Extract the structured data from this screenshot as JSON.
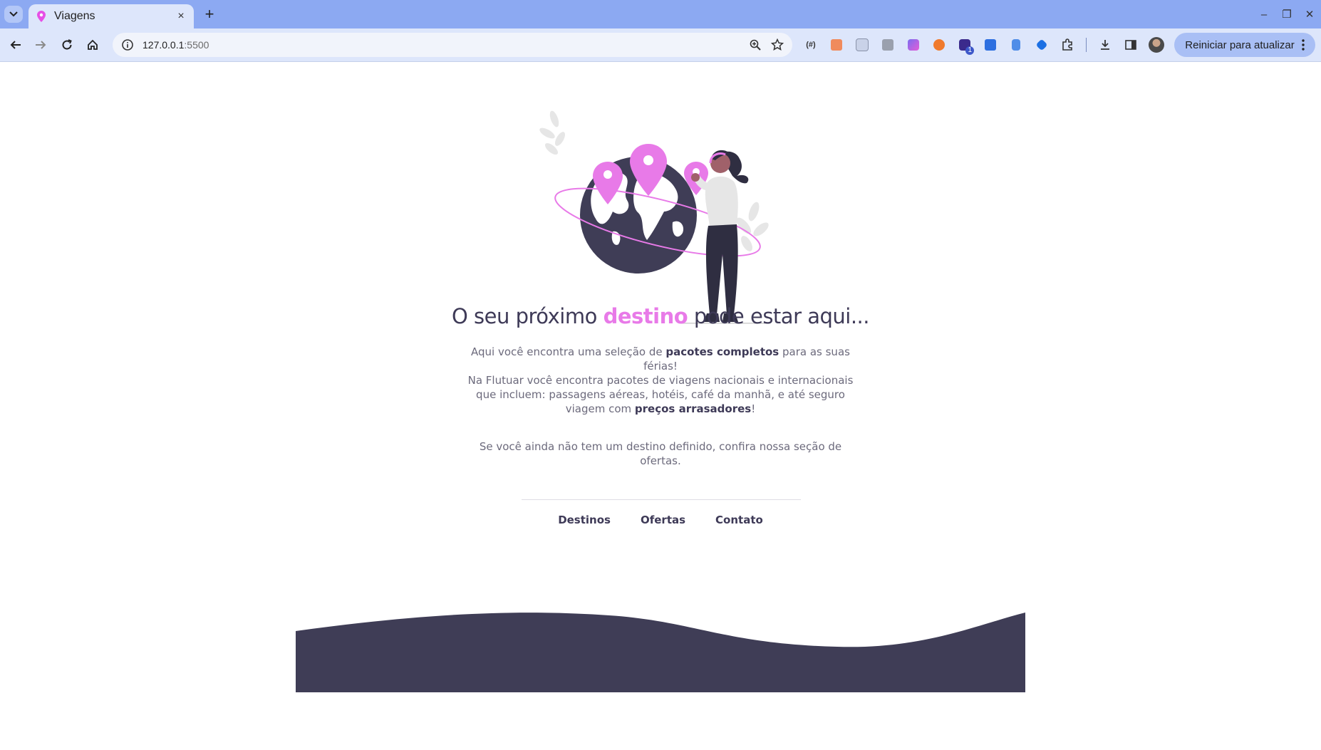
{
  "browser": {
    "tab_title": "Viagens",
    "tab_close": "×",
    "new_tab": "+",
    "url_host": "127.0.0.1",
    "url_port": ":5500",
    "update_button": "Reiniciar para atualizar",
    "extension_badge": "1",
    "window_controls": [
      "–",
      "❐",
      "✕"
    ]
  },
  "hero": {
    "title_before": "O seu próximo ",
    "title_highlight": "destino",
    "title_after": " pode estar aqui...",
    "intro_before": "Aqui você encontra uma seleção de ",
    "intro_bold": "pacotes completos",
    "intro_after": " para as suas férias!",
    "detail_text": "Na Flutuar você encontra pacotes de viagens nacionais e internacionais que incluem: passagens aéreas, hotéis, café da manhã, e até seguro viagem com ",
    "detail_bold": "preços arrasadores",
    "detail_end": "!",
    "offer_text": "Se você ainda não tem um destino definido, confira nossa seção de ofertas."
  },
  "footer_nav": {
    "items": [
      "Destinos",
      "Ofertas",
      "Contato"
    ]
  },
  "colors": {
    "accent": "#e87ae8",
    "dark": "#3e3a57",
    "chrome_tab_bar": "#8ca9f2",
    "chrome_toolbar": "#dde6fb"
  }
}
